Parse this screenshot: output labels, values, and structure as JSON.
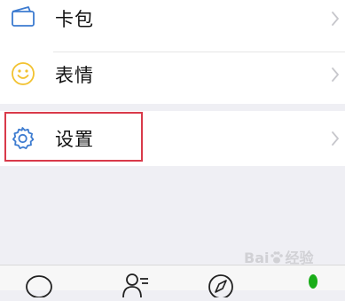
{
  "menu": {
    "items": [
      {
        "label": "卡包",
        "icon": "card-wallet-icon"
      },
      {
        "label": "表情",
        "icon": "sticker-smiley-icon"
      },
      {
        "label": "设置",
        "icon": "gear-icon"
      }
    ],
    "chevron_icon": "chevron-right-icon"
  },
  "tabbar": {
    "tabs": [
      {
        "icon": "chat-bubble-icon"
      },
      {
        "icon": "contacts-icon"
      },
      {
        "icon": "compass-icon"
      },
      {
        "icon": "person-icon",
        "active": true
      }
    ]
  },
  "watermark": {
    "text_part1": "Bai",
    "text_part2": "经验"
  },
  "colors": {
    "page_background": "#efeff4",
    "row_background": "#ffffff",
    "icon_blue": "#3c7bd0",
    "icon_yellow": "#f2c230",
    "chevron": "#c7c7cc",
    "highlight_border": "#d93a4a",
    "active_tab": "#1aad19"
  }
}
